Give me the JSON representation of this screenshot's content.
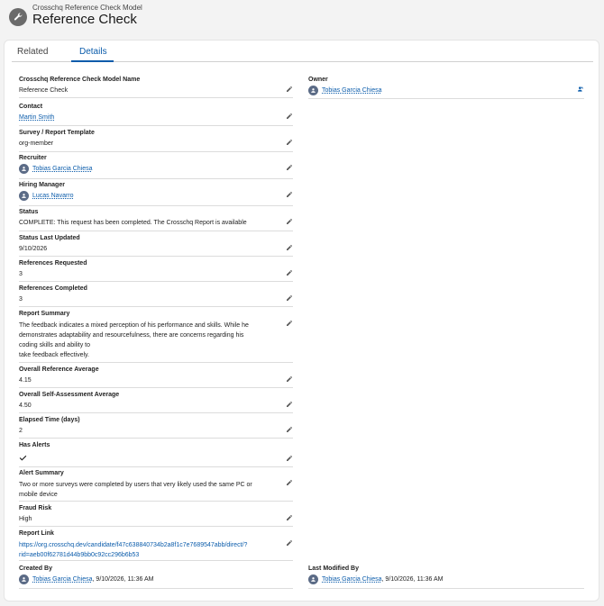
{
  "header": {
    "object_label": "Crosschq Reference Check Model",
    "title": "Reference Check",
    "icon": "wrench-icon"
  },
  "tabs": [
    {
      "label": "Related",
      "active": false
    },
    {
      "label": "Details",
      "active": true
    }
  ],
  "fields": {
    "model_name": {
      "label": "Crosschq Reference Check Model Name",
      "value": "Reference Check"
    },
    "contact": {
      "label": "Contact",
      "value": "Martin Smith"
    },
    "survey_template": {
      "label": "Survey / Report Template",
      "value": "org-member"
    },
    "recruiter": {
      "label": "Recruiter",
      "value": "Tobias Garcia Chiesa"
    },
    "hiring_manager": {
      "label": "Hiring Manager",
      "value": "Lucas Navarro"
    },
    "status": {
      "label": "Status",
      "value": "COMPLETE: This request has been completed. The Crosschq Report is available"
    },
    "status_last_updated": {
      "label": "Status Last Updated",
      "value": "9/10/2026"
    },
    "references_requested": {
      "label": "References Requested",
      "value": "3"
    },
    "references_completed": {
      "label": "References Completed",
      "value": "3"
    },
    "report_summary": {
      "label": "Report Summary",
      "lines": [
        "The feedback indicates a mixed perception of his performance and skills. While he",
        "demonstrates adaptability and resourcefulness, there are concerns regarding his",
        "coding skills and ability to",
        "take feedback effectively."
      ]
    },
    "overall_reference_average": {
      "label": "Overall Reference Average",
      "value": "4.15"
    },
    "overall_self_assessment_average": {
      "label": "Overall Self-Assessment Average",
      "value": "4.50"
    },
    "elapsed_time": {
      "label": "Elapsed Time (days)",
      "value": "2"
    },
    "has_alerts": {
      "label": "Has Alerts",
      "checked": true
    },
    "alert_summary": {
      "label": "Alert Summary",
      "lines": [
        "Two or more surveys were completed by users that very likely used the same PC or",
        "mobile device"
      ]
    },
    "fraud_risk": {
      "label": "Fraud Risk",
      "value": "High"
    },
    "report_link": {
      "label": "Report Link",
      "lines": [
        "https://org.crosschq.dev/candidate/f47c638840734b2a8f1c7e7689547abb/direct/?",
        "rid=aeb00f62781d44b9bb0c92cc296b6b53"
      ]
    },
    "created_by": {
      "label": "Created By",
      "user": "Tobias Garcia Chiesa",
      "timestamp": ", 9/10/2026, 11:36 AM"
    },
    "owner": {
      "label": "Owner",
      "value": "Tobias Garcia Chiesa"
    },
    "last_modified_by": {
      "label": "Last Modified By",
      "user": "Tobias Garcia Chiesa",
      "timestamp": ", 9/10/2026, 11:36 AM"
    }
  },
  "colors": {
    "link": "#0b5cab",
    "icon_gray": "#6b6b6b",
    "avatar": "#5b6b86"
  }
}
